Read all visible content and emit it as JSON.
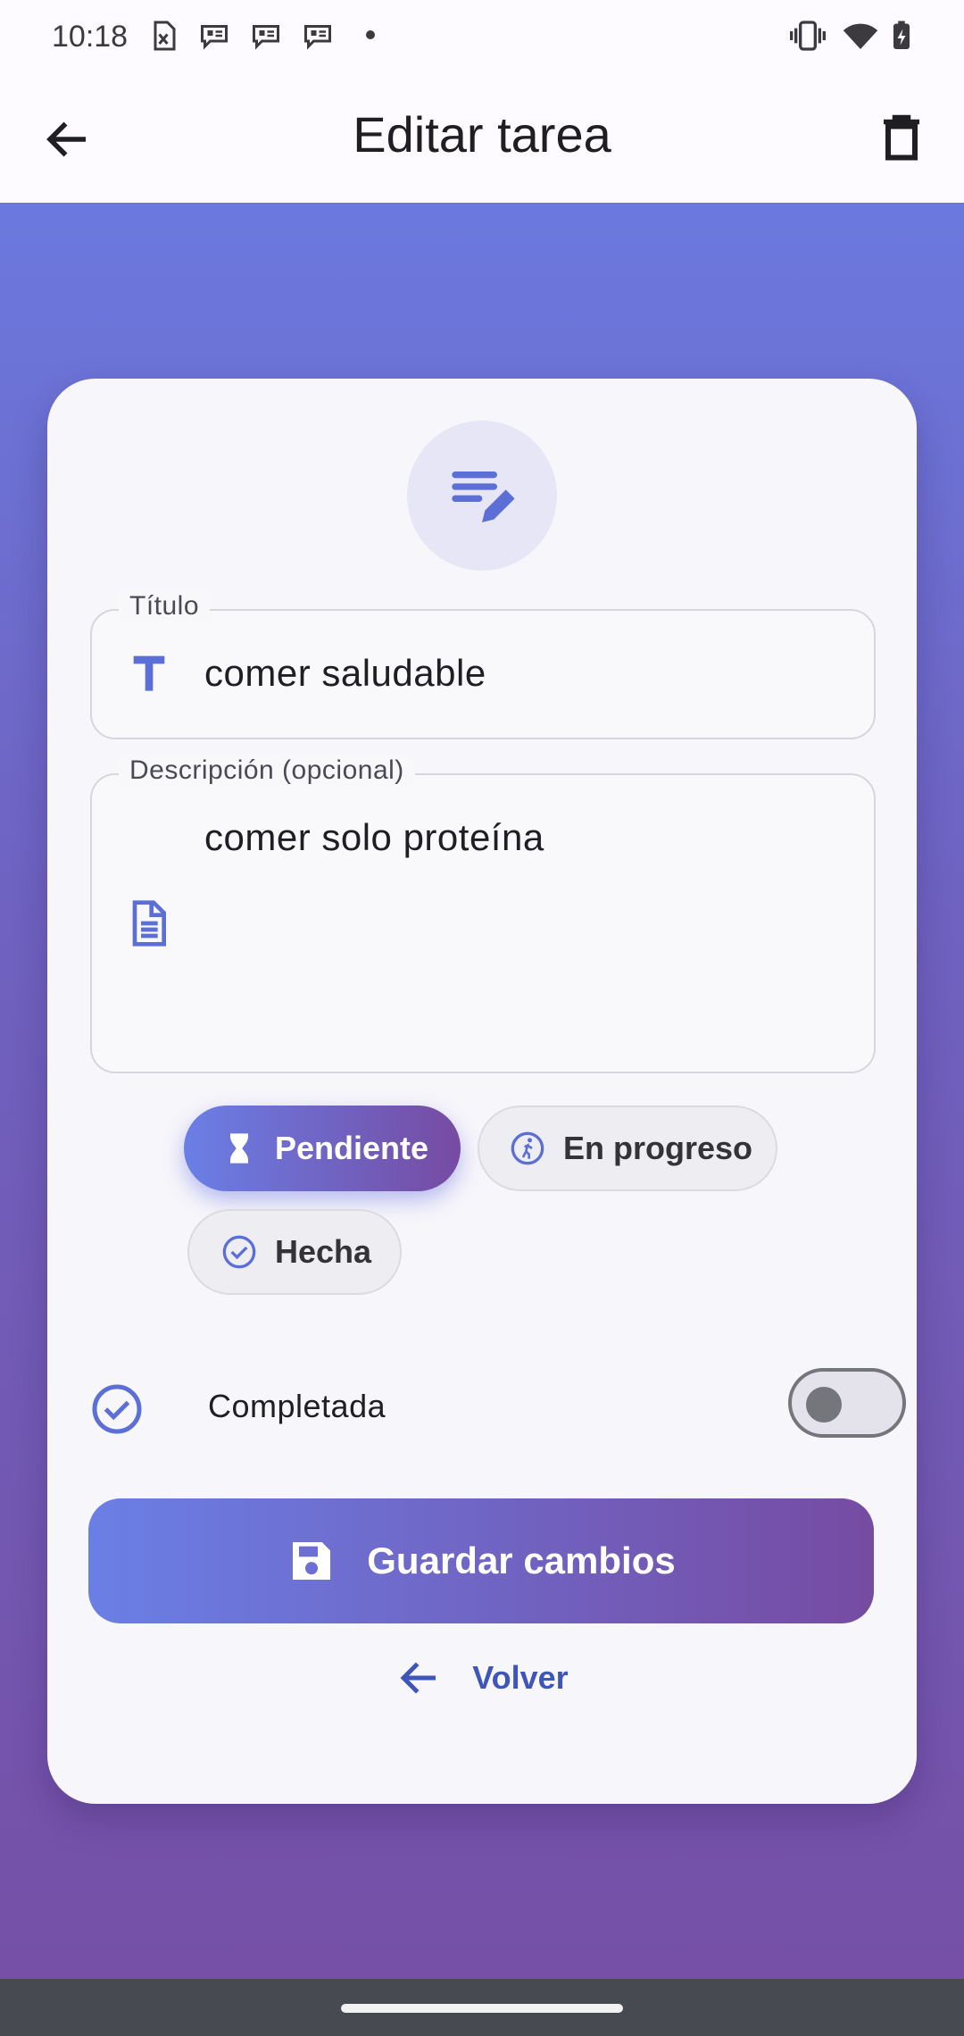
{
  "status_bar": {
    "time": "10:18",
    "notification_icons": [
      "spreadsheet-icon",
      "chat-icon",
      "chat-icon",
      "chat-icon",
      "dot-icon"
    ],
    "system_icons": [
      "vibrate-icon",
      "wifi-icon",
      "battery-charging-icon"
    ]
  },
  "app_bar": {
    "title": "Editar tarea",
    "back_icon": "arrow-back-icon",
    "delete_icon": "trash-icon"
  },
  "form": {
    "header_icon": "edit-note-icon",
    "title_field": {
      "label": "Título",
      "value": "comer saludable",
      "icon": "title-t-icon"
    },
    "description_field": {
      "label": "Descripción (opcional)",
      "value": "comer solo proteína",
      "icon": "document-icon"
    },
    "status_chips": [
      {
        "label": "Pendiente",
        "icon": "hourglass-icon",
        "selected": true
      },
      {
        "label": "En progreso",
        "icon": "running-icon",
        "selected": false
      },
      {
        "label": "Hecha",
        "icon": "check-circle-icon",
        "selected": false
      }
    ],
    "completed": {
      "label": "Completada",
      "icon": "check-circle-icon",
      "value": false
    },
    "save_button": {
      "label": "Guardar cambios",
      "icon": "save-icon"
    },
    "back_link": {
      "label": "Volver",
      "icon": "arrow-back-icon"
    }
  },
  "colors": {
    "accent": "#667eea",
    "accent_end": "#764ba2",
    "link": "#3f55b8"
  }
}
